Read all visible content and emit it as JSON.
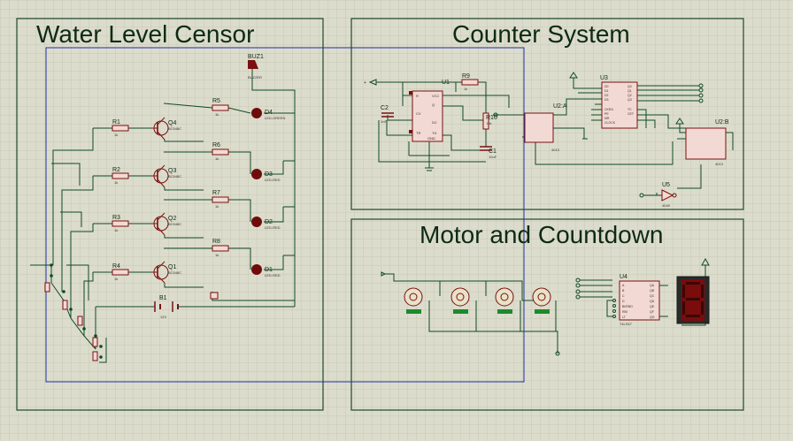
{
  "sections": {
    "water_level": {
      "title": "Water Level Censor"
    },
    "counter": {
      "title": "Counter System"
    },
    "motor": {
      "title": "Motor and Countdown"
    }
  },
  "components": {
    "buzzer": {
      "ref": "BUZ1",
      "value": "BUZZER"
    },
    "resistors": [
      {
        "ref": "R1",
        "value": "1k"
      },
      {
        "ref": "R2",
        "value": "1k"
      },
      {
        "ref": "R3",
        "value": "1k"
      },
      {
        "ref": "R4",
        "value": "1k"
      },
      {
        "ref": "R5",
        "value": "1k"
      },
      {
        "ref": "R6",
        "value": "1k"
      },
      {
        "ref": "R7",
        "value": "1k"
      },
      {
        "ref": "R8",
        "value": "1k"
      },
      {
        "ref": "R9",
        "value": "1k"
      },
      {
        "ref": "R10",
        "value": "10k"
      }
    ],
    "transistors": [
      {
        "ref": "Q4",
        "value": "BC548C"
      },
      {
        "ref": "Q3",
        "value": "BC548C"
      },
      {
        "ref": "Q2",
        "value": "BC548C"
      },
      {
        "ref": "Q1",
        "value": "BC548C"
      }
    ],
    "leds": [
      {
        "ref": "D4",
        "value": "LED-GREEN"
      },
      {
        "ref": "D3",
        "value": "LED-RED"
      },
      {
        "ref": "D2",
        "value": "LED-RED"
      },
      {
        "ref": "D1",
        "value": "LED-RED"
      }
    ],
    "battery": {
      "ref": "B1",
      "value": "12V"
    },
    "timer": {
      "ref": "U1",
      "pins": [
        "R",
        "DC",
        "Q",
        "TH",
        "TR",
        "CV",
        "VCC",
        "GND"
      ]
    },
    "caps": [
      {
        "ref": "C2",
        "value": "1nF"
      },
      {
        "ref": "C1",
        "value": "10uF"
      }
    ],
    "counter_ic": {
      "ref": "U3",
      "pins_left": [
        "D0",
        "D1",
        "D2",
        "D3",
        "CKEN",
        "PE",
        "MR",
        "CLOCK"
      ],
      "pins_right": [
        "Q0",
        "Q1",
        "Q2",
        "Q3",
        "TC",
        "CET"
      ]
    },
    "flipflop_a": {
      "ref": "U2:A",
      "part": "4013"
    },
    "flipflop_b": {
      "ref": "U2:B",
      "part": "4013"
    },
    "inverter": {
      "ref": "U5",
      "part": "4049"
    },
    "decoder": {
      "ref": "U4",
      "part": "74LS47",
      "pins_left": [
        "A",
        "B",
        "C",
        "D",
        "RBI",
        "LT",
        "BI/RBO"
      ],
      "pins_right": [
        "QA",
        "QB",
        "QC",
        "QD",
        "QE",
        "QF",
        "QG"
      ]
    }
  },
  "colors": {
    "background": "#dcdccc",
    "grid": "#c9c9b8",
    "wire": "#0e4a24",
    "frame": "#1f4a2c",
    "blue_frame": "#2030a0",
    "component": "#7a1010",
    "ic_fill": "#f3d9d4",
    "led": "#6e0c0c",
    "display": "#7a0c0c",
    "motor_base": "#1c8a2e"
  }
}
